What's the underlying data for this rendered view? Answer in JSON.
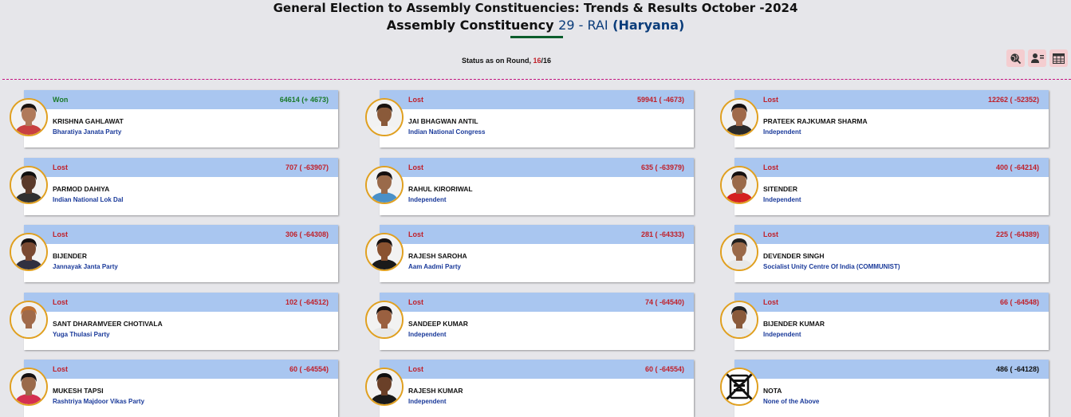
{
  "header": {
    "title": "General Election to Assembly Constituencies: Trends & Results October -2024",
    "subtitle_prefix": "Assembly Constituency",
    "constituency_number": "29 - RAI",
    "state": "(Haryana)"
  },
  "status": {
    "label": "Status as on Round,",
    "current_round": "16",
    "separator": "/",
    "total_rounds": "16"
  },
  "toolbar": {
    "icons": [
      "globe-search-icon",
      "candidate-list-icon",
      "table-view-icon"
    ]
  },
  "colors": {
    "won": "#1a7a2a",
    "lost": "#c0202a",
    "party_text": "#1a3a9a",
    "card_bar": "#a9c6f0",
    "divider": "#c4107e"
  },
  "candidates": [
    {
      "status": "Won",
      "votes": "64614 (+ 4673)",
      "name": "KRISHNA GAHLAWAT",
      "party": "Bharatiya Janata Party",
      "skin": "#b07a5a",
      "hair": "#1a1410",
      "shirt": "#c84040"
    },
    {
      "status": "Lost",
      "votes": "59941 ( -4673)",
      "name": "JAI BHAGWAN ANTIL",
      "party": "Indian National Congress",
      "skin": "#8a5a3a",
      "hair": "#1a1410",
      "shirt": "#f4f4f4"
    },
    {
      "status": "Lost",
      "votes": "12262 ( -52352)",
      "name": "PRATEEK RAJKUMAR SHARMA",
      "party": "Independent",
      "skin": "#a06a4a",
      "hair": "#151010",
      "shirt": "#2a2a2a"
    },
    {
      "status": "Lost",
      "votes": "707 ( -63907)",
      "name": "PARMOD DAHIYA",
      "party": "Indian National Lok Dal",
      "skin": "#5a3a2a",
      "hair": "#101010",
      "shirt": "#303030"
    },
    {
      "status": "Lost",
      "votes": "635 ( -63979)",
      "name": "RAHUL KIRORIWAL",
      "party": "Independent",
      "skin": "#9a6a4a",
      "hair": "#151010",
      "shirt": "#4a90c8"
    },
    {
      "status": "Lost",
      "votes": "400 ( -64214)",
      "name": "SITENDER",
      "party": "Independent",
      "skin": "#9a6a4a",
      "hair": "#151010",
      "shirt": "#d42020"
    },
    {
      "status": "Lost",
      "votes": "306 ( -64308)",
      "name": "BIJENDER",
      "party": "Jannayak Janta Party",
      "skin": "#7a4a32",
      "hair": "#151010",
      "shirt": "#303040"
    },
    {
      "status": "Lost",
      "votes": "281 ( -64333)",
      "name": "RAJESH SAROHA",
      "party": "Aam Aadmi Party",
      "skin": "#8a5230",
      "hair": "#151010",
      "shirt": "#1a1a1a"
    },
    {
      "status": "Lost",
      "votes": "225 ( -64389)",
      "name": "DEVENDER SINGH",
      "party": "Socialist Unity Centre Of India (COMMUNIST)",
      "skin": "#9a6a4a",
      "hair": "#202020",
      "shirt": "#e8e8e8"
    },
    {
      "status": "Lost",
      "votes": "102 ( -64512)",
      "name": "SANT DHARAMVEER CHOTIVALA",
      "party": "Yuga Thulasi Party",
      "skin": "#a06a4a",
      "hair": "#c07030",
      "shirt": "#f0f0f0"
    },
    {
      "status": "Lost",
      "votes": "74 ( -64540)",
      "name": "SANDEEP KUMAR",
      "party": "Independent",
      "skin": "#9a6040",
      "hair": "#151010",
      "shirt": "#e8e8e8"
    },
    {
      "status": "Lost",
      "votes": "66 ( -64548)",
      "name": "BIJENDER KUMAR",
      "party": "Independent",
      "skin": "#8a5a3a",
      "hair": "#202020",
      "shirt": "#e8e8e8"
    },
    {
      "status": "Lost",
      "votes": "60 ( -64554)",
      "name": "MUKESH TAPSI",
      "party": "Rashtriya Majdoor Vikas Party",
      "skin": "#9a6a4a",
      "hair": "#151010",
      "shirt": "#d43050"
    },
    {
      "status": "Lost",
      "votes": "60 ( -64554)",
      "name": "RAJESH KUMAR",
      "party": "Independent",
      "skin": "#6a4028",
      "hair": "#101010",
      "shirt": "#1a1a1a"
    },
    {
      "status": "",
      "votes": "486 ( -64128)",
      "name": "NOTA",
      "party": "None of the Above",
      "icon": "nota-icon"
    }
  ]
}
